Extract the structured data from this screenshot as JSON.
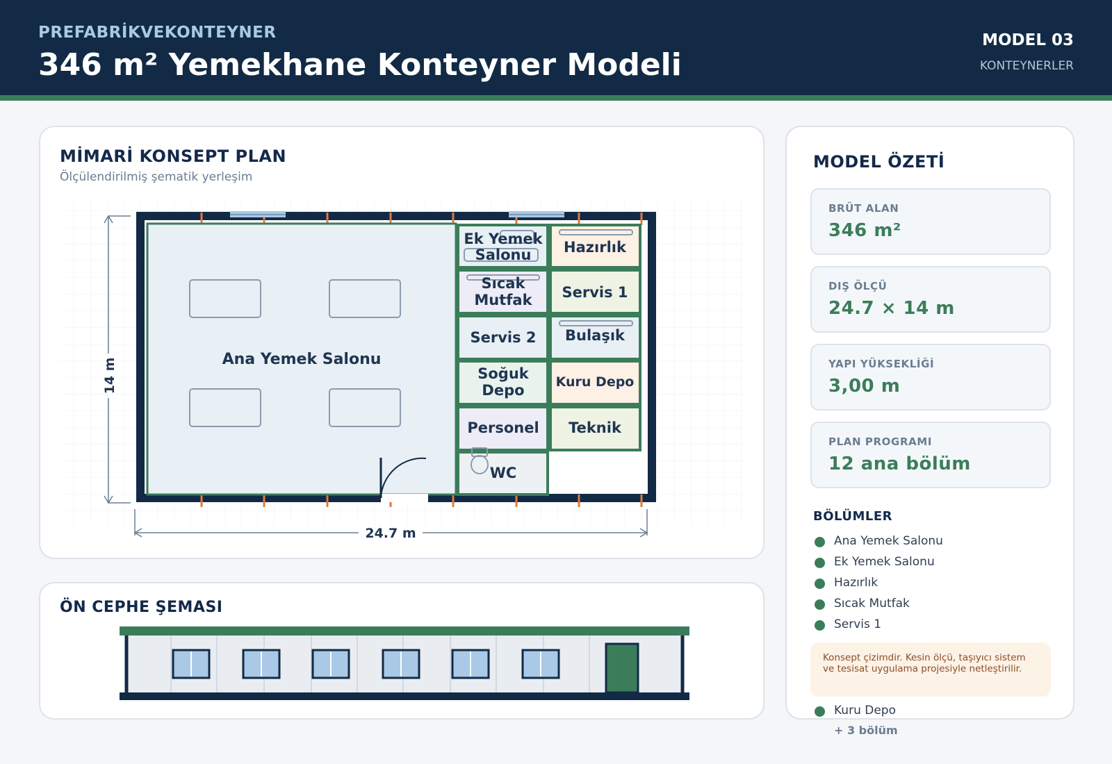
{
  "header": {
    "brand": "PREFABRİKVEKONTEYNER",
    "title": "346 m² Yemekhane Konteyner Modeli",
    "model_no": "MODEL 03",
    "category": "KONTEYNERLER"
  },
  "plan": {
    "title": "MİMARİ KONSEPT PLAN",
    "subtitle": "Ölçülendirilmiş şematik yerleşim",
    "dim_width": "24.7 m",
    "dim_depth": "14 m",
    "rooms": {
      "main_hall": "Ana Yemek Salonu",
      "ek_yemek_line1": "Ek Yemek",
      "ek_yemek_line2": "Salonu",
      "hazirlik": "Hazırlık",
      "sicak_line1": "Sıcak",
      "sicak_line2": "Mutfak",
      "servis1": "Servis 1",
      "servis2": "Servis 2",
      "bulasik": "Bulaşık",
      "soguk_line1": "Soğuk",
      "soguk_line2": "Depo",
      "kuru_depo": "Kuru Depo",
      "personel": "Personel",
      "teknik": "Teknik",
      "wc": "WC"
    }
  },
  "elevation": {
    "title": "ÖN CEPHE ŞEMASI"
  },
  "summary": {
    "title": "MODEL ÖZETİ",
    "stats": [
      {
        "label": "BRÜT ALAN",
        "value": "346 m²"
      },
      {
        "label": "DIŞ ÖLÇÜ",
        "value": "24.7 × 14 m"
      },
      {
        "label": "YAPI YÜKSEKLİĞİ",
        "value": "3,00 m"
      },
      {
        "label": "PLAN PROGRAMI",
        "value": "12 ana bölüm"
      }
    ],
    "sections_title": "BÖLÜMLER",
    "sections": [
      "Ana Yemek Salonu",
      "Ek Yemek Salonu",
      "Hazırlık",
      "Sıcak Mutfak",
      "Servis 1",
      "Kuru Depo"
    ],
    "more": "+ 3 bölüm",
    "note": "Konsept çizimdir. Kesin ölçü, taşıyıcı sistem ve tesisat uygulama projesiyle netleştirilir."
  },
  "colors": {
    "navy": "#122a45",
    "green": "#3b7d5a",
    "accent_orange": "#e07a3a"
  }
}
